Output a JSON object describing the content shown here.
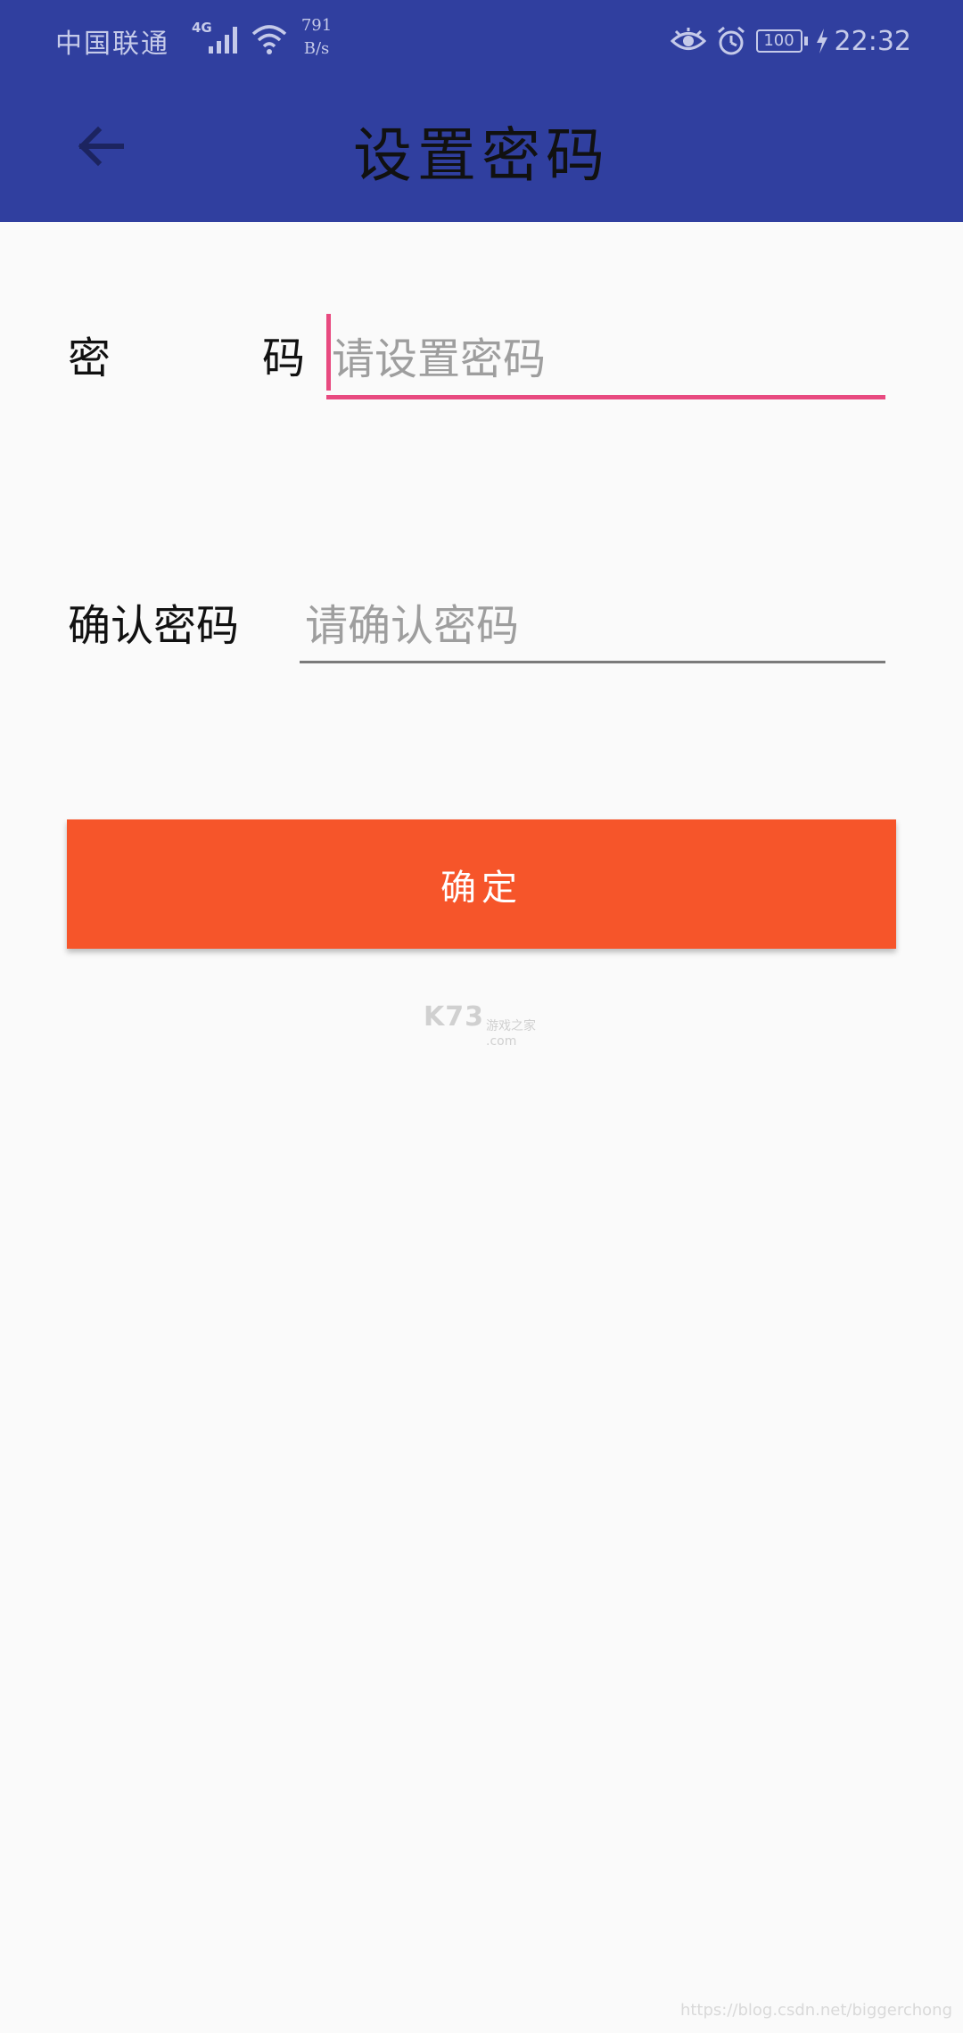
{
  "colors": {
    "appbar": "#303f9f",
    "status_text": "#c5cae9",
    "focus_accent": "#e84a80",
    "button_bg": "#f6552a",
    "background": "#fafafa"
  },
  "status_bar": {
    "carrier": "中国联通",
    "network_type": "4G",
    "speed_value": "791",
    "speed_unit": "B/s",
    "battery": "100",
    "time": "22:32",
    "icons": [
      "signal-icon",
      "wifi-icon",
      "eye-icon",
      "alarm-icon",
      "battery-icon",
      "charging-icon"
    ]
  },
  "header": {
    "title": "设置密码",
    "back_icon": "arrow-left-icon"
  },
  "form": {
    "password": {
      "label_first": "密",
      "label_last": "码",
      "placeholder": "请设置密码",
      "value": ""
    },
    "confirm": {
      "label": "确认密码",
      "placeholder": "请确认密码",
      "value": ""
    },
    "submit_label": "确定"
  },
  "watermark": {
    "logo": "K73",
    "logo_sub": "游戏之家",
    "logo_domain": ".com",
    "url": "https://blog.csdn.net/biggerchong"
  }
}
